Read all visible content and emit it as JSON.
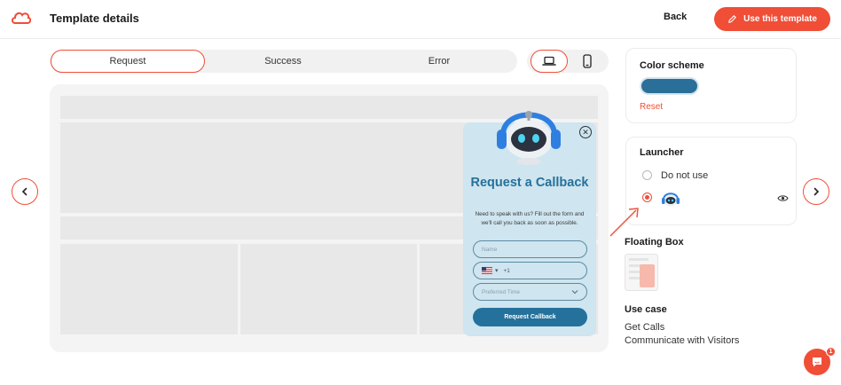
{
  "header": {
    "title": "Template details",
    "back_label": "Back",
    "use_template_label": "Use this template"
  },
  "tabs": [
    {
      "label": "Request",
      "active": true
    },
    {
      "label": "Success",
      "active": false
    },
    {
      "label": "Error",
      "active": false
    }
  ],
  "devices": [
    {
      "icon": "laptop-icon",
      "active": true
    },
    {
      "icon": "phone-icon",
      "active": false
    }
  ],
  "widget": {
    "title": "Request a Callback",
    "description": "Need to speak with us? Fill out the form and we'll call you back as soon as possible.",
    "name_placeholder": "Name",
    "phone_code": "+1",
    "time_placeholder": "Preferred Time",
    "submit_label": "Request Callback"
  },
  "color_scheme": {
    "title": "Color scheme",
    "color": "#2a6f99",
    "reset_label": "Reset"
  },
  "launcher": {
    "title": "Launcher",
    "options": [
      {
        "label": "Do not use",
        "checked": false
      },
      {
        "label": "",
        "checked": true,
        "icon": "robot-icon"
      }
    ]
  },
  "floating_box": {
    "title": "Floating Box"
  },
  "use_case": {
    "title": "Use case",
    "items": [
      "Get Calls",
      "Communicate with Visitors"
    ]
  },
  "chat": {
    "badge_count": "1"
  },
  "colors": {
    "accent": "#f04e37",
    "widget_blue": "#24719c",
    "widget_bg": "#cfe5ef"
  }
}
